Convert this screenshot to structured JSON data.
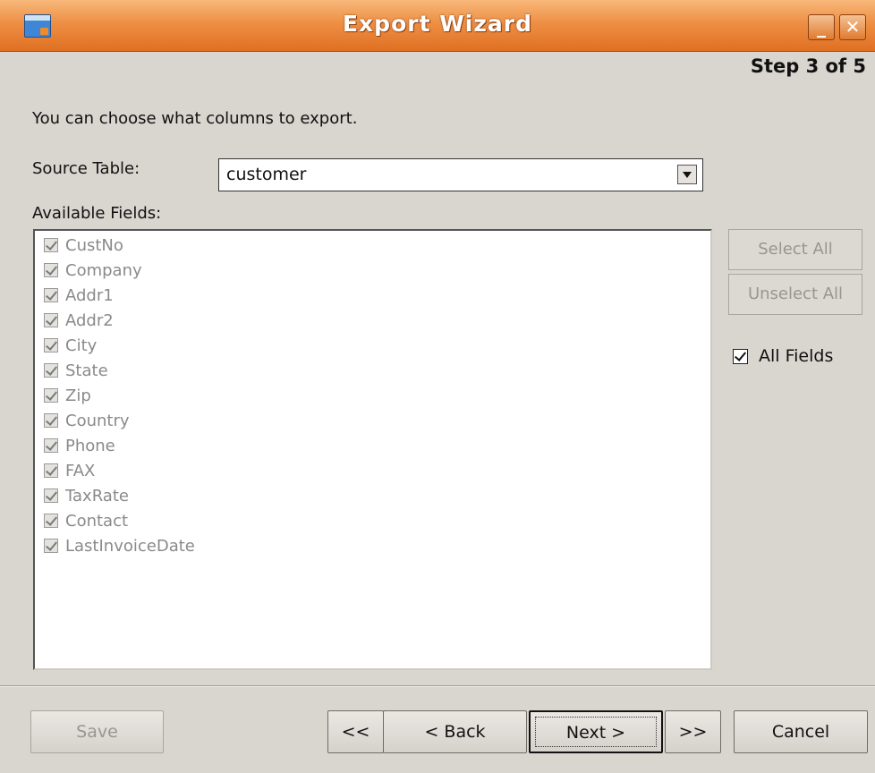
{
  "window": {
    "title": "Export Wizard",
    "minimize_glyph": "_",
    "close_glyph": "✕"
  },
  "step": "Step 3 of 5",
  "instructions": "You can choose what columns to export.",
  "source": {
    "label": "Source Table:",
    "value": "customer"
  },
  "fields": {
    "label": "Available Fields:",
    "items": [
      {
        "name": "CustNo",
        "checked": true
      },
      {
        "name": "Company",
        "checked": true
      },
      {
        "name": "Addr1",
        "checked": true
      },
      {
        "name": "Addr2",
        "checked": true
      },
      {
        "name": "City",
        "checked": true
      },
      {
        "name": "State",
        "checked": true
      },
      {
        "name": "Zip",
        "checked": true
      },
      {
        "name": "Country",
        "checked": true
      },
      {
        "name": "Phone",
        "checked": true
      },
      {
        "name": "FAX",
        "checked": true
      },
      {
        "name": "TaxRate",
        "checked": true
      },
      {
        "name": "Contact",
        "checked": true
      },
      {
        "name": "LastInvoiceDate",
        "checked": true
      }
    ]
  },
  "side": {
    "select_all": "Select All",
    "unselect_all": "Unselect All",
    "all_fields": "All Fields",
    "all_fields_checked": true
  },
  "buttons": {
    "save": "Save",
    "first": "<<",
    "back": "< Back",
    "next": "Next >",
    "last": ">>",
    "cancel": "Cancel"
  },
  "icons": {
    "app": "export-app-icon",
    "dropdown": "chevron-down-icon",
    "check": "checkmark-icon"
  },
  "colors": {
    "titlebar": "#e8822f",
    "background": "#d9d5cf"
  }
}
